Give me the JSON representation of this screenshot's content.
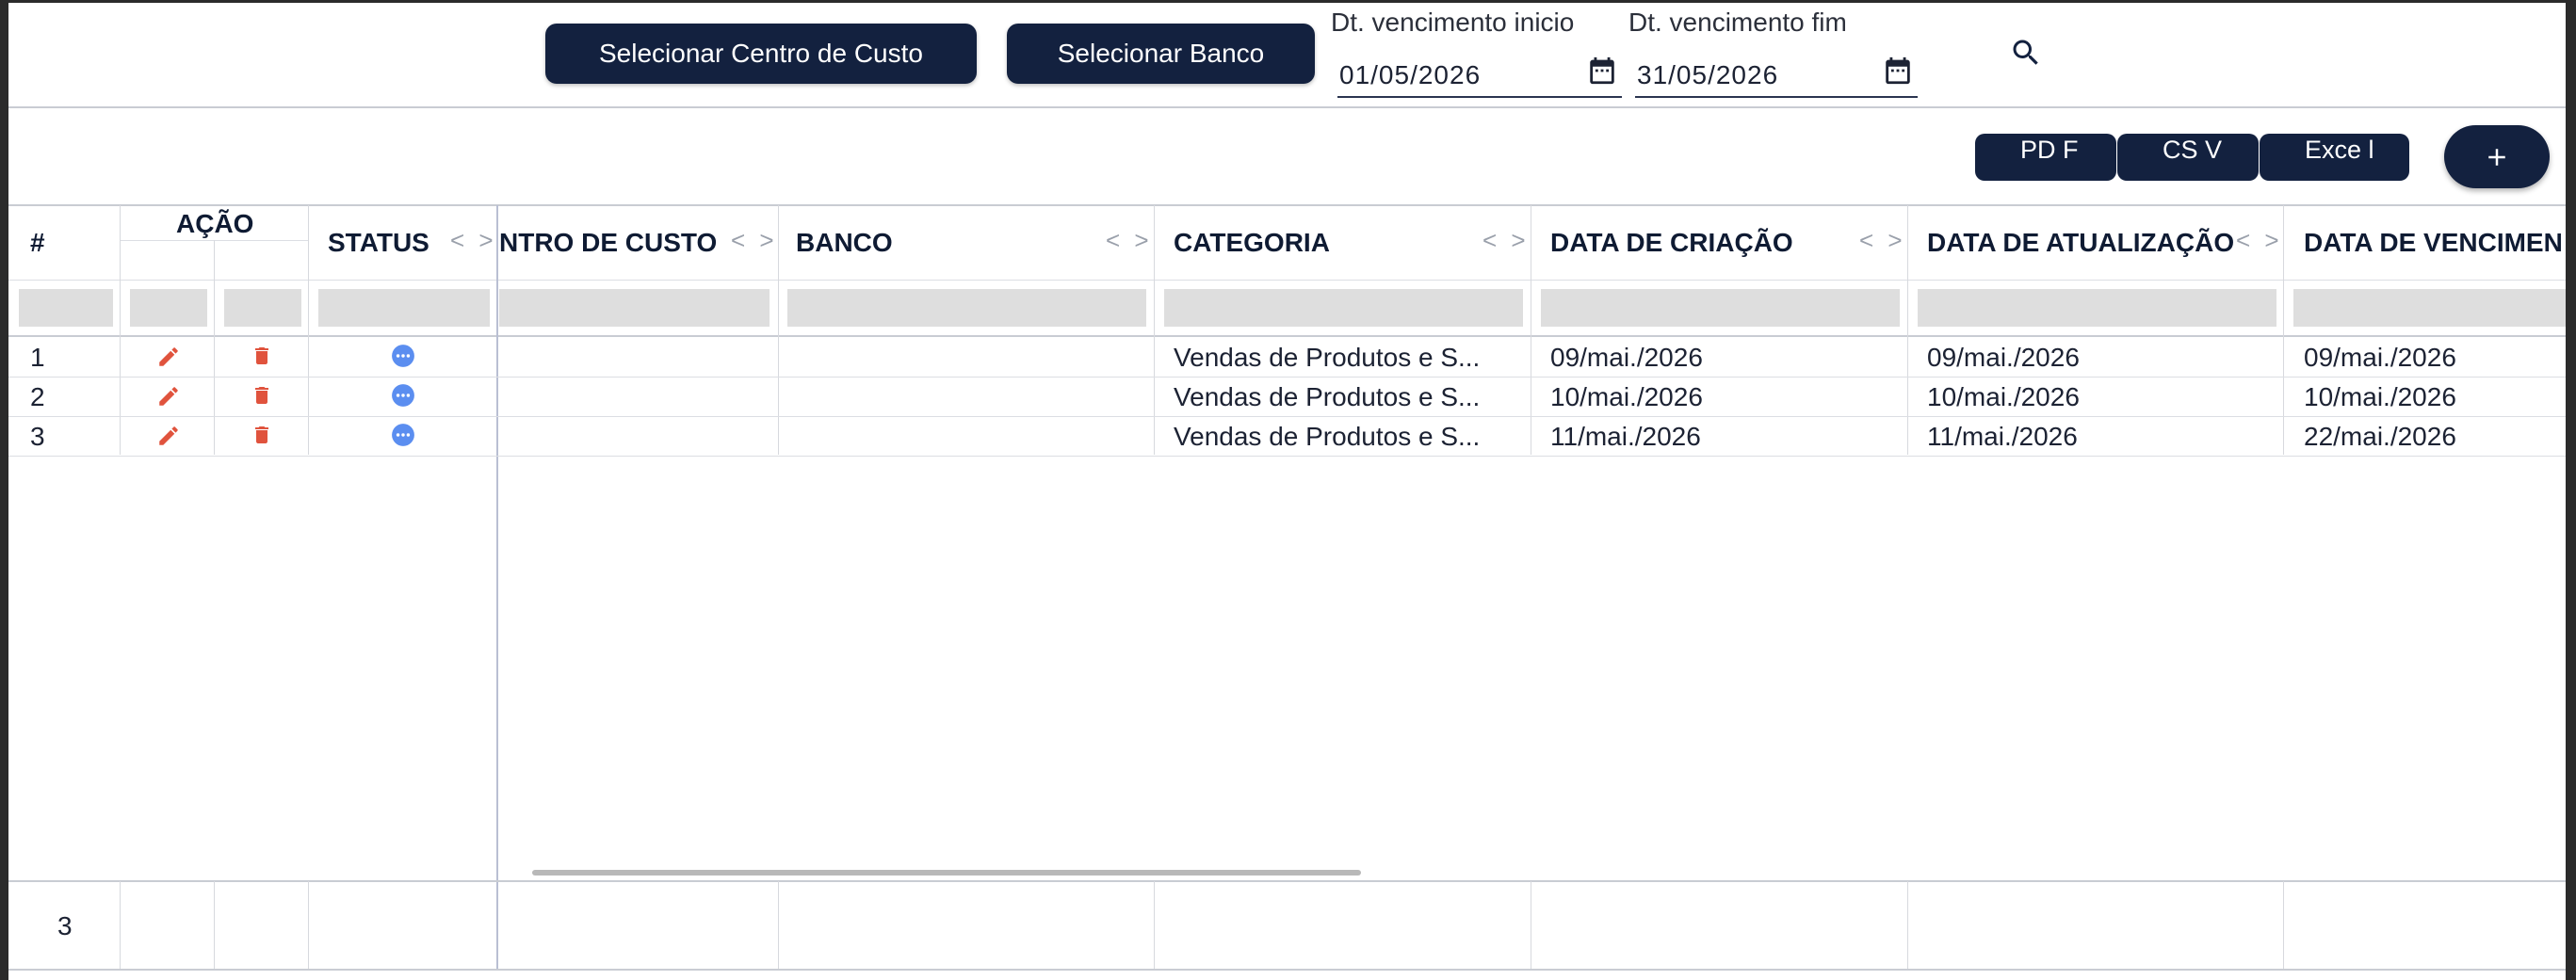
{
  "filters": {
    "centro_custo_button": "Selecionar Centro de Custo",
    "banco_button": "Selecionar Banco",
    "dt_inicio_label": "Dt. vencimento inicio",
    "dt_inicio_value": "01/05/2026",
    "dt_fim_label": "Dt. vencimento fim",
    "dt_fim_value": "31/05/2026"
  },
  "toolbar": {
    "pdf_label": "PD F",
    "csv_label": "CS V",
    "excel_label": "Exce l",
    "add_label": "+"
  },
  "grid": {
    "headers": {
      "index": "#",
      "acao": "AÇÃO",
      "status": "STATUS",
      "centro_custo": "NTRO DE CUSTO",
      "banco": "BANCO",
      "categoria": "CATEGORIA",
      "data_criacao": "DATA DE CRIAÇÃO",
      "data_atualizacao": "DATA DE ATUALIZAÇÃO",
      "data_vencimento": "DATA DE VENCIMEN"
    },
    "sort_glyph": "<>",
    "rows": [
      {
        "index": "1",
        "categoria": "Vendas de Produtos e S...",
        "data_criacao": "09/mai./2026",
        "data_atualizacao": "09/mai./2026",
        "data_vencimento": "09/mai./2026"
      },
      {
        "index": "2",
        "categoria": "Vendas de Produtos e S...",
        "data_criacao": "10/mai./2026",
        "data_atualizacao": "10/mai./2026",
        "data_vencimento": "10/mai./2026"
      },
      {
        "index": "3",
        "categoria": "Vendas de Produtos e S...",
        "data_criacao": "11/mai./2026",
        "data_atualizacao": "11/mai./2026",
        "data_vencimento": "22/mai./2026"
      }
    ],
    "footer_count": "3"
  },
  "colors": {
    "primary": "#13213f",
    "action_red": "#e0533d",
    "status_blue": "#5b8ef0"
  },
  "icons": [
    "calendar-icon",
    "search-icon",
    "plus-icon",
    "edit-icon",
    "delete-icon",
    "more-icon"
  ]
}
